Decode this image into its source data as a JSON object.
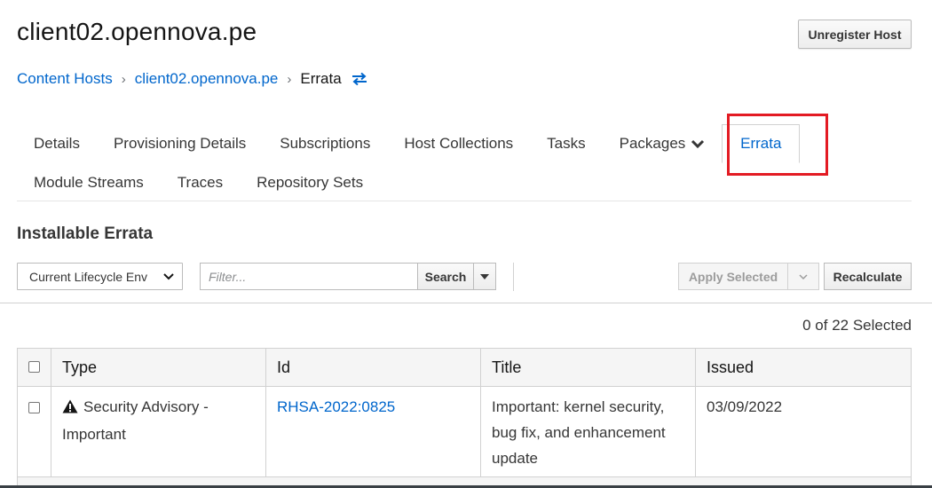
{
  "page": {
    "title": "client02.opennova.pe",
    "unregister_label": "Unregister Host"
  },
  "breadcrumb": {
    "items": [
      {
        "label": "Content Hosts"
      },
      {
        "label": "client02.opennova.pe"
      }
    ],
    "current": "Errata"
  },
  "tabs": {
    "row1": [
      {
        "label": "Details"
      },
      {
        "label": "Provisioning Details"
      },
      {
        "label": "Subscriptions"
      },
      {
        "label": "Host Collections"
      },
      {
        "label": "Tasks"
      },
      {
        "label": "Packages"
      }
    ],
    "active": "Errata",
    "row2": [
      {
        "label": "Module Streams"
      },
      {
        "label": "Traces"
      },
      {
        "label": "Repository Sets"
      }
    ]
  },
  "section": {
    "title": "Installable Errata"
  },
  "toolbar": {
    "lifecycle_select": "Current Lifecycle Env",
    "filter_placeholder": "Filter...",
    "search_label": "Search",
    "apply_label": "Apply Selected",
    "recalculate_label": "Recalculate"
  },
  "selection": {
    "count_text": "0 of 22 Selected"
  },
  "table": {
    "headers": [
      "Type",
      "Id",
      "Title",
      "Issued"
    ],
    "rows": [
      {
        "type": "Security Advisory - Important",
        "id": "RHSA-2022:0825",
        "title": "Important: kernel security, bug fix, and enhancement update",
        "issued": "03/09/2022"
      }
    ]
  },
  "colors": {
    "link": "#0066cc",
    "highlight": "#e31b23"
  },
  "icons": {
    "breadcrumb_switch": "switch-arrows-icon",
    "type_icon": "warning-triangle-icon"
  }
}
